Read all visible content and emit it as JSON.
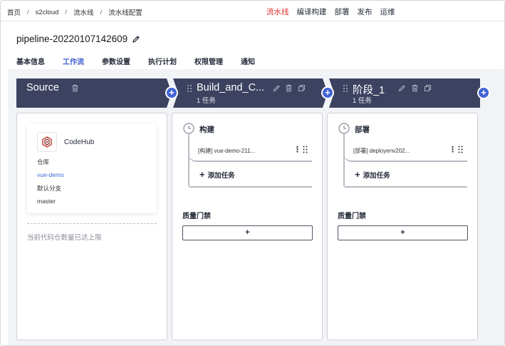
{
  "breadcrumb": [
    "首页",
    "s2cloud",
    "流水线",
    "流水线配置"
  ],
  "topnav": [
    "流水线",
    "编译构建",
    "部署",
    "发布",
    "运维"
  ],
  "title": "pipeline-20220107142609",
  "tabs": [
    "基本信息",
    "工作流",
    "参数设置",
    "执行计划",
    "权限管理",
    "通知"
  ],
  "stages": [
    {
      "name": "Source"
    },
    {
      "name": "Build_and_C...",
      "sub": "1 任务"
    },
    {
      "name": "阶段_1",
      "sub": "1 任务"
    }
  ],
  "source": {
    "repo_name": "CodeHub",
    "repo_label": "仓库",
    "repo_value": "vue-demo",
    "branch_label": "默认分支",
    "branch_value": "master",
    "limit_text": "当前代码仓数量已达上限"
  },
  "build": {
    "job_title": "构建",
    "task": "[构建] vue-demo-211...",
    "add_task": "添加任务",
    "gate_title": "质量门禁",
    "gate_btn": "+"
  },
  "deploy": {
    "job_title": "部署",
    "task": "[部署] deployenv202...",
    "add_task": "添加任务",
    "gate_title": "质量门禁",
    "gate_btn": "+"
  },
  "plus_label": "+",
  "colors": {
    "accent": "#4364d5",
    "active_nav": "#e0302c",
    "stage_bg": "#3c4260"
  }
}
